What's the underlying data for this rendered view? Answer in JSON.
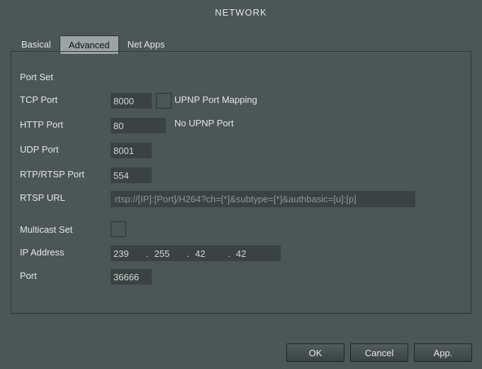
{
  "window_title": "NETWORK",
  "tabs": {
    "basical": "Basical",
    "advanced": "Advanced",
    "netapps": "Net Apps"
  },
  "active_tab": "advanced",
  "section": {
    "port_set": "Port Set",
    "multicast_set": "Multicast Set"
  },
  "labels": {
    "tcp_port": "TCP Port",
    "http_port": "HTTP Port",
    "udp_port": "UDP Port",
    "rtp_rtsp_port": "RTP/RTSP Port",
    "rtsp_url": "RTSP URL",
    "ip_address": "IP Address",
    "port": "Port",
    "upnp_port_mapping": "UPNP Port Mapping",
    "no_upnp_port": "No UPNP Port"
  },
  "values": {
    "tcp_port": "8000",
    "http_port": "80",
    "udp_port": "8001",
    "rtp_rtsp_port": "554",
    "rtsp_url": "rtsp://[IP]:[Port]/H264?ch=[*]&subtype=[*]&authbasic=[u]:[p]",
    "ip_a": "239",
    "ip_b": "255",
    "ip_c": "42",
    "ip_d": "42",
    "multicast_port": "36666"
  },
  "buttons": {
    "ok": "OK",
    "cancel": "Cancel",
    "apply": "App."
  }
}
